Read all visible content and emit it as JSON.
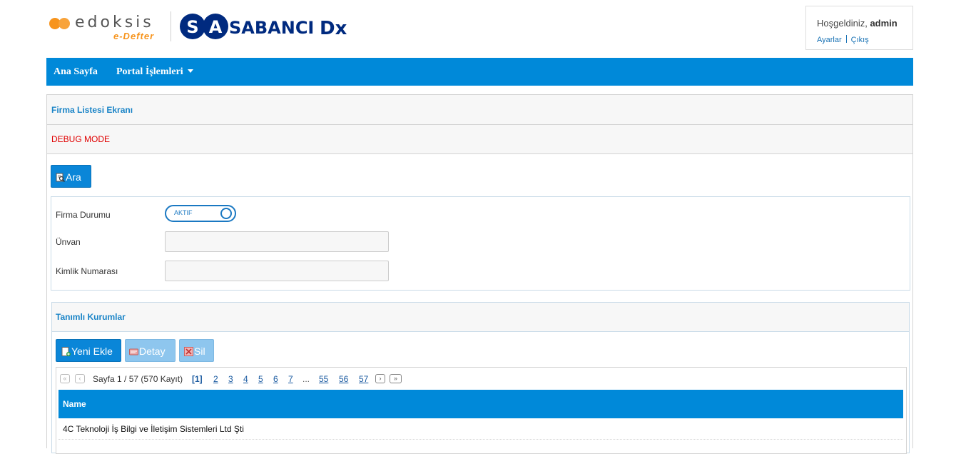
{
  "header": {
    "logo_edoksis": "edoksis",
    "logo_edoksis_sub": "e-Defter",
    "logo_sabanci": "SABANCI",
    "logo_sabanci_dx": "Dx",
    "welcome_prefix": "Hoşgeldiniz, ",
    "username": "admin",
    "settings_link": "Ayarlar",
    "logout_link": "Çıkış"
  },
  "nav": {
    "home": "Ana Sayfa",
    "portal": "Portal İşlemleri"
  },
  "panel": {
    "title": "Firma Listesi Ekranı",
    "debug": "DEBUG MODE"
  },
  "search": {
    "button": "Ara",
    "status_label": "Firma Durumu",
    "status_value": "AKTIF",
    "title_label": "Ünvan",
    "title_value": "",
    "id_label": "Kimlik Numarası",
    "id_value": ""
  },
  "institutions": {
    "title": "Tanımlı Kurumlar",
    "add_button": "Yeni Ekle",
    "detail_button": "Detay",
    "delete_button": "Sil"
  },
  "pager": {
    "info": "Sayfa 1 / 57 (570 Kayıt)",
    "current": "[1]",
    "pages": [
      "2",
      "3",
      "4",
      "5",
      "6",
      "7"
    ],
    "ellipsis": "...",
    "last_pages": [
      "55",
      "56",
      "57"
    ]
  },
  "grid": {
    "column": "Name",
    "rows": [
      "4C Teknoloji İş Bilgi ve İletişim Sistemleri Ltd Şti"
    ]
  },
  "colors": {
    "brand_blue": "#0089d9",
    "edoksis_orange": "#f7941d",
    "sabanci_navy": "#002a7f",
    "debug_red": "#e00000"
  }
}
